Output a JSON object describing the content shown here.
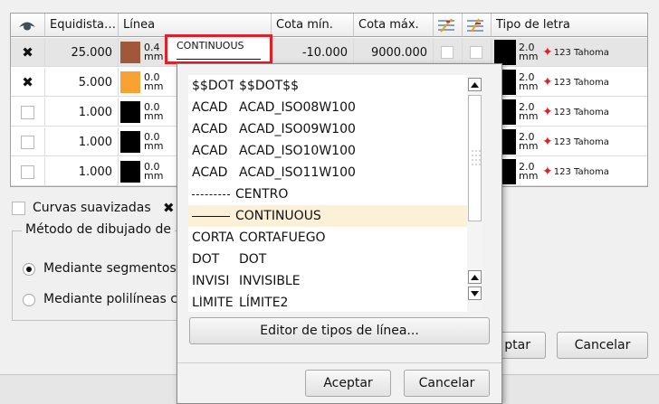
{
  "table": {
    "headers": {
      "equidistancia": "Equidista…",
      "linea": "Línea",
      "cota_min": "Cota mín.",
      "cota_max": "Cota máx.",
      "tipo_letra": "Tipo de letra"
    },
    "rows": [
      {
        "equid": "25.000",
        "color": "#a0573a",
        "weight": [
          "0.4",
          "mm"
        ],
        "linetype": "CONTINUOUS",
        "min": "-10.000",
        "max": "9000.000",
        "size": [
          "2.0",
          "mm"
        ],
        "font": "123 Tahoma"
      },
      {
        "equid": "5.000",
        "color": "#f7a233",
        "weight": [
          "0.0",
          "mm"
        ],
        "linetype": "",
        "min": "",
        "max": "",
        "size": [
          "2.0",
          "mm"
        ],
        "font": "123 Tahoma"
      },
      {
        "equid": "1.000",
        "color": "#000000",
        "weight": [
          "0.0",
          "mm"
        ],
        "linetype": "",
        "min": "",
        "max": "",
        "size": [
          "2.0",
          "mm"
        ],
        "font": "123 Tahoma"
      },
      {
        "equid": "1.000",
        "color": "#000000",
        "weight": [
          "0.0",
          "mm"
        ],
        "linetype": "",
        "min": "",
        "max": "",
        "size": [
          "2.0",
          "mm"
        ],
        "font": "123 Tahoma"
      },
      {
        "equid": "1.000",
        "color": "#000000",
        "weight": [
          "0.0",
          "mm"
        ],
        "linetype": "",
        "min": "",
        "max": "",
        "size": [
          "2.0",
          "mm"
        ],
        "font": "123 Tahoma"
      }
    ]
  },
  "lower": {
    "curvas_suavizadas": "Curvas suavizadas",
    "metodo_title": "Método de dibujado de",
    "opt_segmentos": "Mediante segmentos",
    "opt_polilineas": "Mediante polilíneas c",
    "aceptar_partial": "ptar",
    "cancelar": "Cancelar"
  },
  "popup": {
    "items": [
      {
        "preview": "$$DOT",
        "name": "$$DOT$$"
      },
      {
        "preview": "ACAD",
        "name": "ACAD_ISO08W100"
      },
      {
        "preview": "ACAD",
        "name": "ACAD_ISO09W100"
      },
      {
        "preview": "ACAD",
        "name": "ACAD_ISO10W100"
      },
      {
        "preview": "ACAD",
        "name": "ACAD_ISO11W100"
      },
      {
        "preview": "",
        "name": "CENTRO"
      },
      {
        "preview": "",
        "name": "CONTINUOUS"
      },
      {
        "preview": "CORTA",
        "name": "CORTAFUEGO"
      },
      {
        "preview": "DOT",
        "name": "DOT"
      },
      {
        "preview": "INVISI",
        "name": "INVISIBLE"
      },
      {
        "preview": "LÍMITE",
        "name": "LÍMITE2"
      }
    ],
    "editor_button": "Editor de tipos de línea...",
    "aceptar": "Aceptar",
    "cancelar": "Cancelar"
  }
}
